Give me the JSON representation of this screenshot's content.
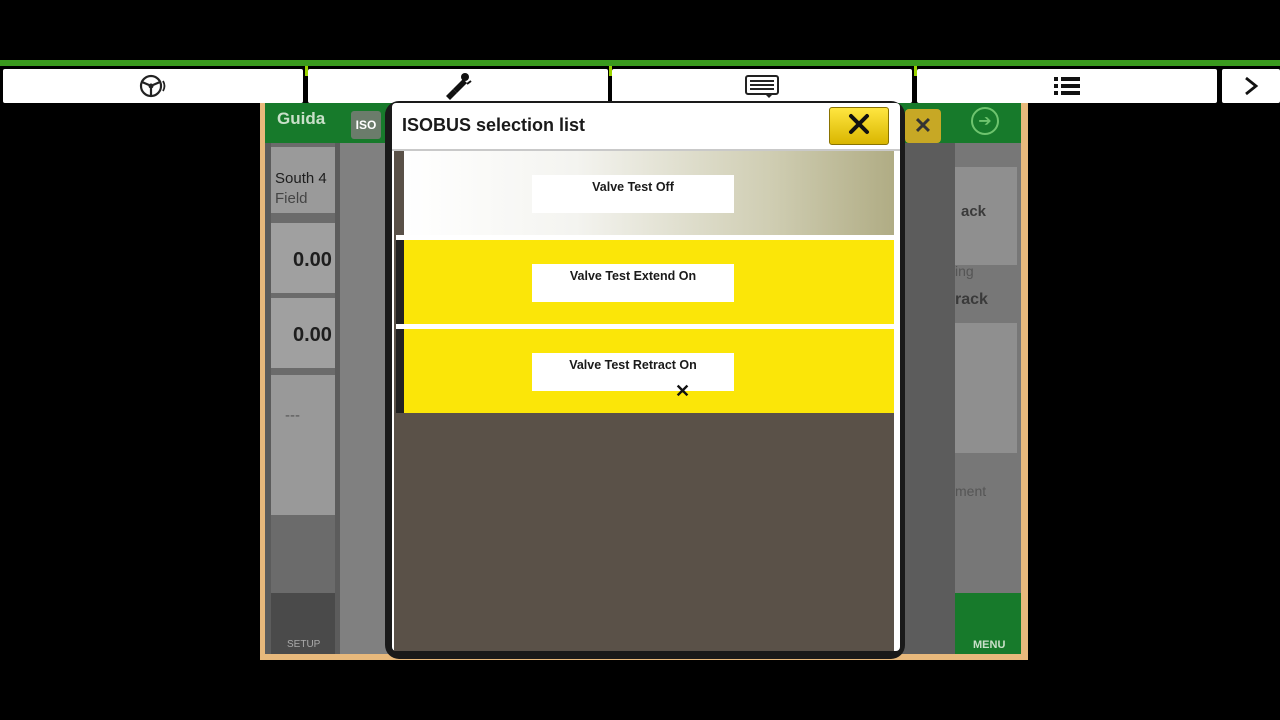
{
  "topbar": {
    "buttons": [
      {
        "name": "guidance-steering",
        "icon": "steering-wheel-icon"
      },
      {
        "name": "implement-hitch",
        "icon": "implement-icon"
      },
      {
        "name": "work-monitor",
        "icon": "monitor-list-icon"
      },
      {
        "name": "shortcut-list",
        "icon": "list-icon"
      },
      {
        "name": "more",
        "icon": "chevron-right-icon"
      }
    ]
  },
  "background_app": {
    "title": "Guida",
    "iso_badge": "ISO",
    "location_line1": "South 4",
    "location_line2": "Field",
    "value1": "0.00",
    "value2": "0.00",
    "next_value": "---",
    "right_labels": [
      "ack",
      "ing",
      "rack",
      "ment"
    ],
    "setup_label": "SETUP",
    "menu_label": "MENU"
  },
  "dialog": {
    "title": "ISOBUS selection list",
    "close_icon": "close-icon",
    "accent": "#fbe608",
    "options": [
      {
        "label": "Valve Test Off",
        "selected": false
      },
      {
        "label": "Valve Test Extend On",
        "selected": true
      },
      {
        "label": "Valve Test Retract On",
        "selected": true
      }
    ]
  }
}
